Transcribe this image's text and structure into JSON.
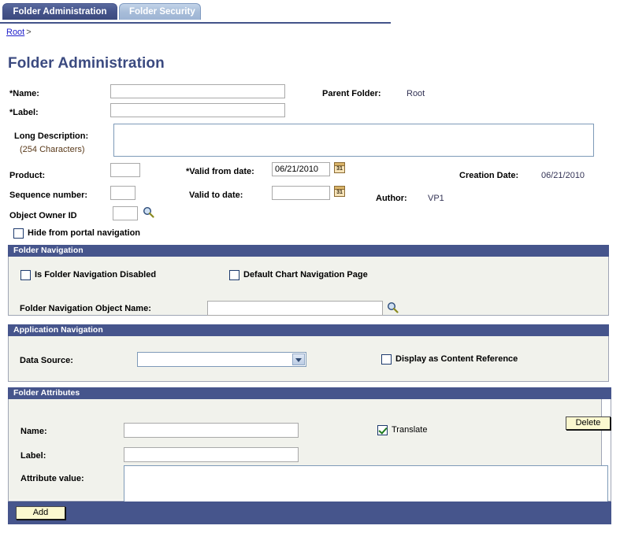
{
  "tabs": [
    {
      "label": "Folder Administration",
      "active": true
    },
    {
      "label": "Folder Security",
      "active": false
    }
  ],
  "breadcrumb": {
    "root_label": "Root",
    "separator": ">"
  },
  "page_title": "Folder Administration",
  "main_form": {
    "name_label": "*Name:",
    "name_value": "",
    "label_label": "*Label:",
    "label_value": "",
    "long_description_label": "Long Description:",
    "long_description_sub": "(254 Characters)",
    "long_description_value": "",
    "parent_folder_label": "Parent Folder:",
    "parent_folder_value": "Root",
    "product_label": "Product:",
    "product_value": "",
    "sequence_number_label": "Sequence number:",
    "sequence_number_value": "",
    "object_owner_id_label": "Object Owner ID",
    "object_owner_id_value": "",
    "valid_from_label": "*Valid from date:",
    "valid_from_value": "06/21/2010",
    "valid_to_label": "Valid to date:",
    "valid_to_value": "",
    "creation_date_label": "Creation Date:",
    "creation_date_value": "06/21/2010",
    "author_label": "Author:",
    "author_value": "VP1",
    "hide_from_portal_label": "Hide from portal navigation",
    "hide_from_portal_checked": false,
    "calendar_icon_text": "31"
  },
  "folder_navigation": {
    "header": "Folder Navigation",
    "is_disabled_label": "Is Folder Navigation Disabled",
    "is_disabled_checked": false,
    "default_chart_label": "Default Chart Navigation Page",
    "default_chart_checked": false,
    "object_name_label": "Folder Navigation Object Name:",
    "object_name_value": ""
  },
  "application_navigation": {
    "header": "Application Navigation",
    "data_source_label": "Data Source:",
    "data_source_value": "",
    "display_as_content_reference_label": "Display as Content Reference",
    "display_as_content_reference_checked": false
  },
  "folder_attributes": {
    "header": "Folder Attributes",
    "name_label": "Name:",
    "name_value": "",
    "label_label": "Label:",
    "label_value": "",
    "attribute_value_label": "Attribute value:",
    "attribute_value": "",
    "translate_label": "Translate",
    "translate_checked": true,
    "delete_button": "Delete",
    "add_button": "Add"
  },
  "colors": {
    "accent_navy": "#46558c",
    "panel_bg": "#f1f2ec",
    "title_blue": "#3b4a80",
    "link_blue": "#2222cc",
    "button_yellow": "#fbf8cf"
  }
}
